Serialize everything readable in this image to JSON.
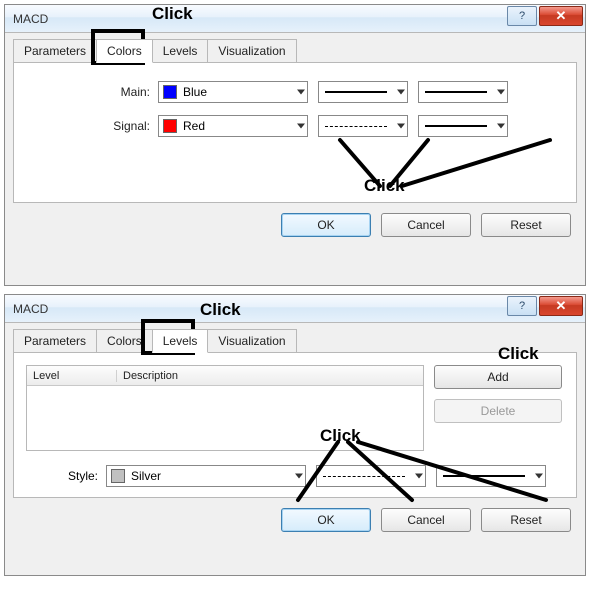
{
  "dialog1": {
    "title": "MACD",
    "tabs": [
      "Parameters",
      "Colors",
      "Levels",
      "Visualization"
    ],
    "active_tab": "Colors",
    "row_main": {
      "label": "Main:",
      "color_name": "Blue"
    },
    "row_signal": {
      "label": "Signal:",
      "color_name": "Red"
    },
    "buttons": {
      "ok": "OK",
      "cancel": "Cancel",
      "reset": "Reset"
    }
  },
  "dialog2": {
    "title": "MACD",
    "tabs": [
      "Parameters",
      "Colors",
      "Levels",
      "Visualization"
    ],
    "active_tab": "Levels",
    "table": {
      "col1": "Level",
      "col2": "Description"
    },
    "add": "Add",
    "delete": "Delete",
    "style_label": "Style:",
    "style_value": "Silver",
    "buttons": {
      "ok": "OK",
      "cancel": "Cancel",
      "reset": "Reset"
    }
  },
  "annotations": {
    "click": "Click"
  },
  "icons": {
    "help": "?",
    "close": "✕"
  }
}
